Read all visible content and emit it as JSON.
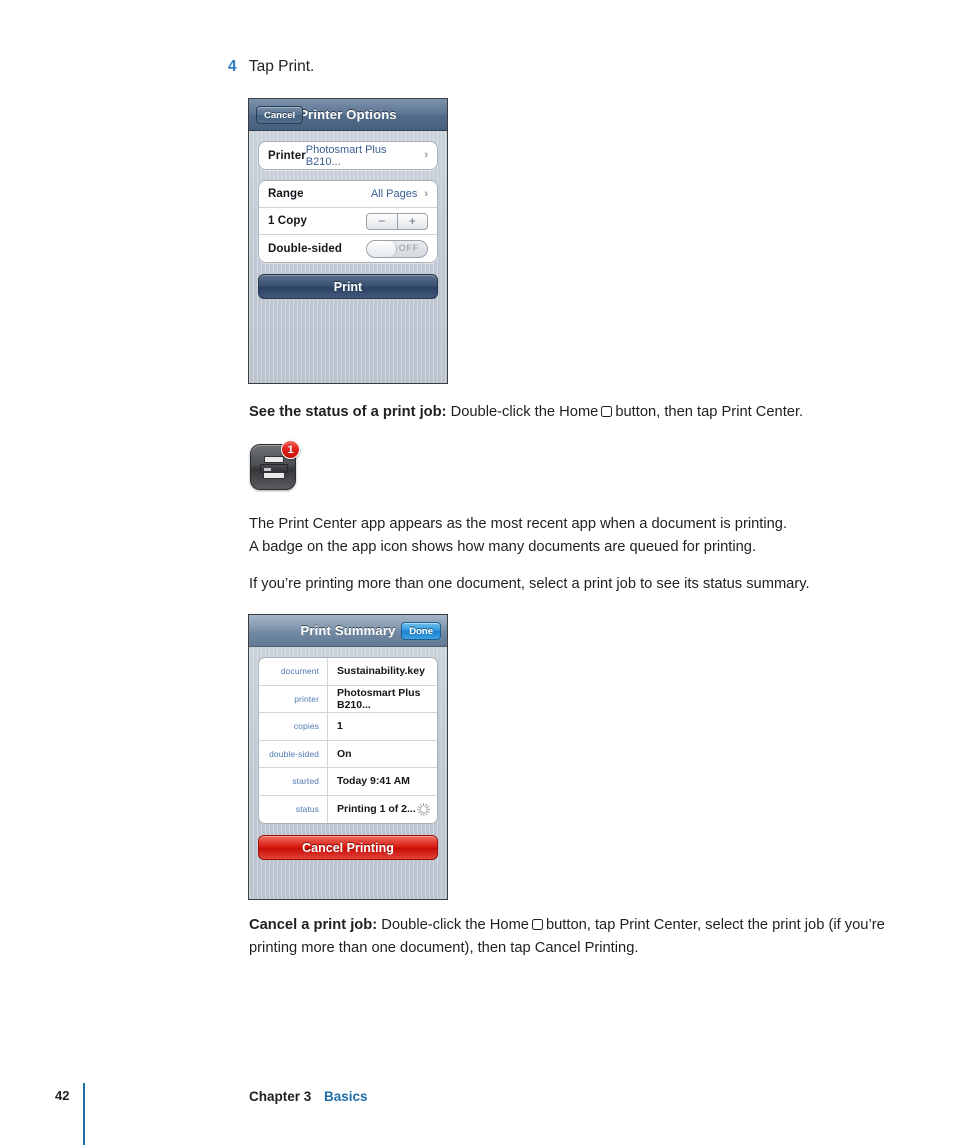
{
  "step": {
    "number": "4",
    "text": "Tap Print."
  },
  "printer_options": {
    "nav": {
      "cancel_label": "Cancel",
      "title": "Printer Options"
    },
    "printer_row": {
      "label": "Printer",
      "value": "Photosmart Plus B210...",
      "chevron": "›"
    },
    "range_row": {
      "label": "Range",
      "value": "All Pages",
      "chevron": "›"
    },
    "copies_row": {
      "label": "1 Copy",
      "minus": "−",
      "plus": "+"
    },
    "double_sided_row": {
      "label": "Double-sided",
      "switch_state": "OFF"
    },
    "print_button": "Print"
  },
  "status_paragraph": {
    "lead": "See the status of a print job:",
    "part1": "Double-click the Home",
    "part2": "button, then tap Print Center."
  },
  "app_icon": {
    "name": "print-center-app-icon",
    "badge_count": "1"
  },
  "about_paragraph": {
    "line1": "The Print Center app appears as the most recent app when a document is printing.",
    "line2": "A badge on the app icon shows how many documents are queued for printing."
  },
  "select_paragraph": {
    "text": "If you’re printing more than one document, select a print job to see its status summary."
  },
  "print_summary": {
    "nav": {
      "title": "Print Summary",
      "done_label": "Done"
    },
    "rows": [
      {
        "key": "document",
        "value": "Sustainability.key"
      },
      {
        "key": "printer",
        "value": "Photosmart Plus B210..."
      },
      {
        "key": "copies",
        "value": "1"
      },
      {
        "key": "double-sided",
        "value": "On"
      },
      {
        "key": "started",
        "value": "Today 9:41 AM"
      },
      {
        "key": "status",
        "value": "Printing 1 of 2..."
      }
    ],
    "cancel_button": "Cancel Printing"
  },
  "cancel_paragraph": {
    "lead": "Cancel a print job:",
    "part1": "Double-click the Home",
    "part2": "button, tap Print Center, select the print job (if you’re printing more than one document), then tap Cancel Printing."
  },
  "footer": {
    "page_number": "42",
    "chapter": "Chapter 3",
    "section": "Basics"
  },
  "colors": {
    "accent_blue": "#1f6ea8",
    "step_blue": "#2b7cc0",
    "badge_red": "#c40f08",
    "cancel_red": "#c70d05"
  }
}
